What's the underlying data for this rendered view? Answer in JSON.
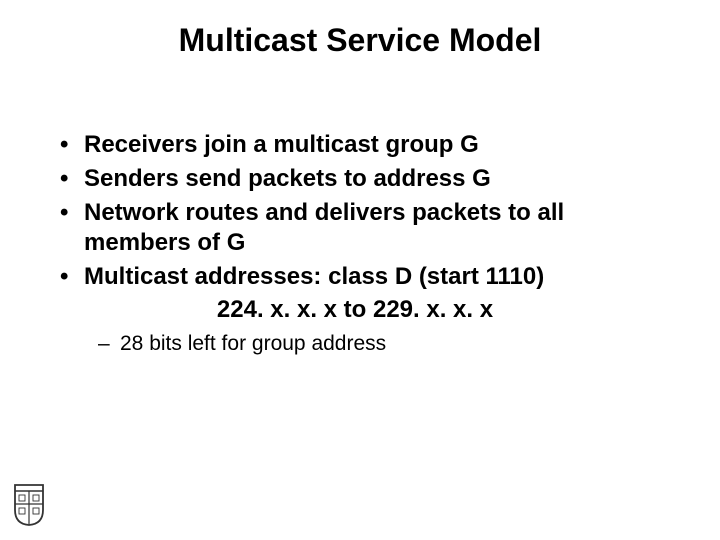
{
  "title": "Multicast Service Model",
  "bullets": [
    "Receivers join a multicast group G",
    "Senders send packets to address G",
    "Network routes and delivers packets to all members of G",
    "Multicast addresses: class D (start 1110)"
  ],
  "address_line": "224. x. x. x to 229. x. x. x",
  "sub_bullets": [
    "28 bits left for group address"
  ]
}
